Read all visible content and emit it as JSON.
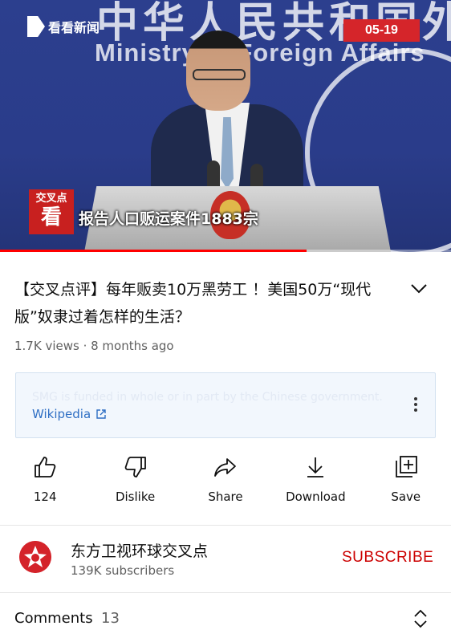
{
  "video": {
    "watermark": "看看新闻",
    "date_badge": "05-19",
    "banner_cn": "中华人民共和国外交部",
    "banner_en": "Ministry of Foreign Affairs",
    "show_logo": "交叉点",
    "show_logo_big": "看",
    "caption": "报告人口贩运案件1883宗",
    "progress_fraction": 0.68
  },
  "title": "【交叉点评】每年贩卖10万黑劳工 ！美国50万“现代版”奴隶过着怎样的生活？",
  "meta": "1.7K views · 8 months ago",
  "info_panel": {
    "text": "SMG is funded in whole or in part by the Chinese government.",
    "link": "Wikipedia"
  },
  "actions": [
    {
      "name": "like",
      "label": "124"
    },
    {
      "name": "dislike",
      "label": "Dislike"
    },
    {
      "name": "share",
      "label": "Share"
    },
    {
      "name": "download",
      "label": "Download"
    },
    {
      "name": "save",
      "label": "Save"
    }
  ],
  "channel": {
    "name": "东方卫视环球交叉点",
    "subscribers": "139K subscribers",
    "subscribe_label": "SUBSCRIBE"
  },
  "comments": {
    "label": "Comments",
    "count": "13"
  },
  "colors": {
    "accent": "#cc0000",
    "link": "#2f6fc4",
    "badge": "#d5252a"
  }
}
